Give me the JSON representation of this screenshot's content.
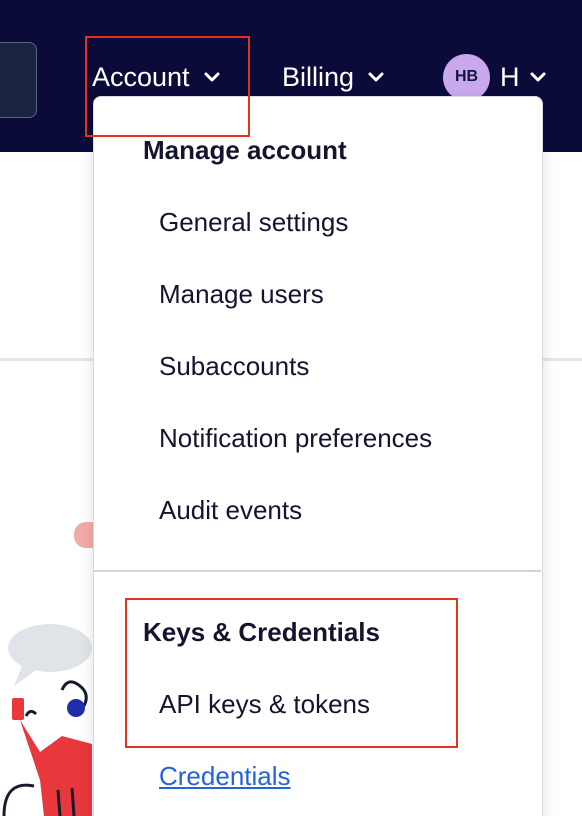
{
  "topbar": {
    "account_label": "Account",
    "billing_label": "Billing",
    "user": {
      "initials": "HB",
      "name": "H"
    }
  },
  "dropdown": {
    "manage": {
      "heading": "Manage account",
      "items": [
        "General settings",
        "Manage users",
        "Subaccounts",
        "Notification preferences",
        "Audit events"
      ]
    },
    "keys": {
      "heading": "Keys & Credentials",
      "items": [
        "API keys & tokens",
        "Credentials"
      ]
    }
  },
  "colors": {
    "topbar_bg": "#0b0b3a",
    "avatar_bg": "#c9a8ee",
    "highlight": "#e2341d",
    "link": "#2563d6"
  }
}
